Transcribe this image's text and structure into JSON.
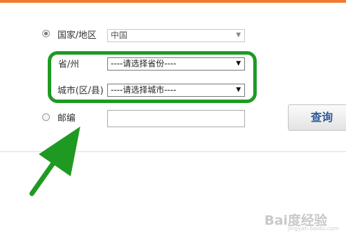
{
  "form": {
    "country": {
      "label": "国家/地区",
      "selected": "中国",
      "radio_checked": true
    },
    "province": {
      "label": "省/州",
      "selected": "----请选择省份----"
    },
    "city": {
      "label": "城市(区/县)",
      "selected": "----请选择城市----"
    },
    "postcode": {
      "label": "邮编",
      "value": "",
      "radio_checked": false
    },
    "query_button_label": "查询"
  },
  "annotation": {
    "highlight_color": "#1e9a22",
    "arrow_color": "#1e9a22"
  },
  "watermark": {
    "text": "Bai度经验",
    "sub": "jingyan.baidu.com"
  },
  "colors": {
    "top_bar": "#f07a2c",
    "button_text": "#2a5a9a"
  }
}
